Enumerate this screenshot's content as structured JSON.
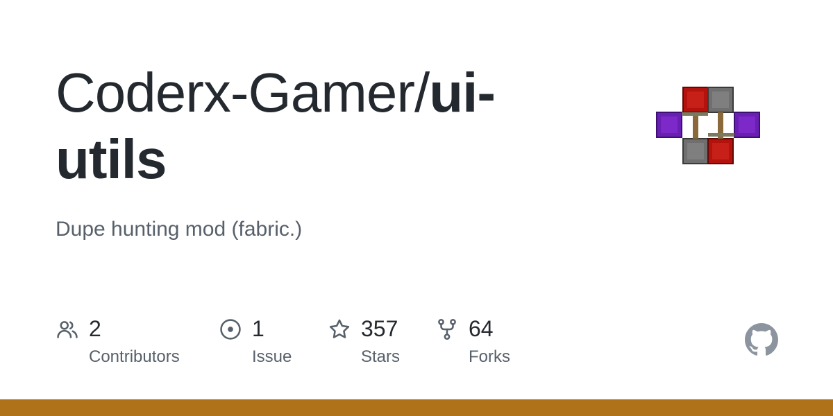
{
  "repo": {
    "owner": "Coderx-Gamer/",
    "name": "ui-utils",
    "description": "Dupe hunting mod (fabric.)"
  },
  "stats": [
    {
      "icon": "people-icon",
      "count": "2",
      "label": "Contributors"
    },
    {
      "icon": "issue-icon",
      "count": "1",
      "label": "Issue"
    },
    {
      "icon": "star-icon",
      "count": "357",
      "label": "Stars"
    },
    {
      "icon": "fork-icon",
      "count": "64",
      "label": "Forks"
    }
  ],
  "colors": {
    "language_bar": "#b07219",
    "text_primary": "#24292f",
    "text_secondary": "#57606a",
    "github_mark": "#8c959f"
  },
  "icons": {
    "repo_logo": "redstone-blocks-logo",
    "brand": "github-mark-icon"
  }
}
